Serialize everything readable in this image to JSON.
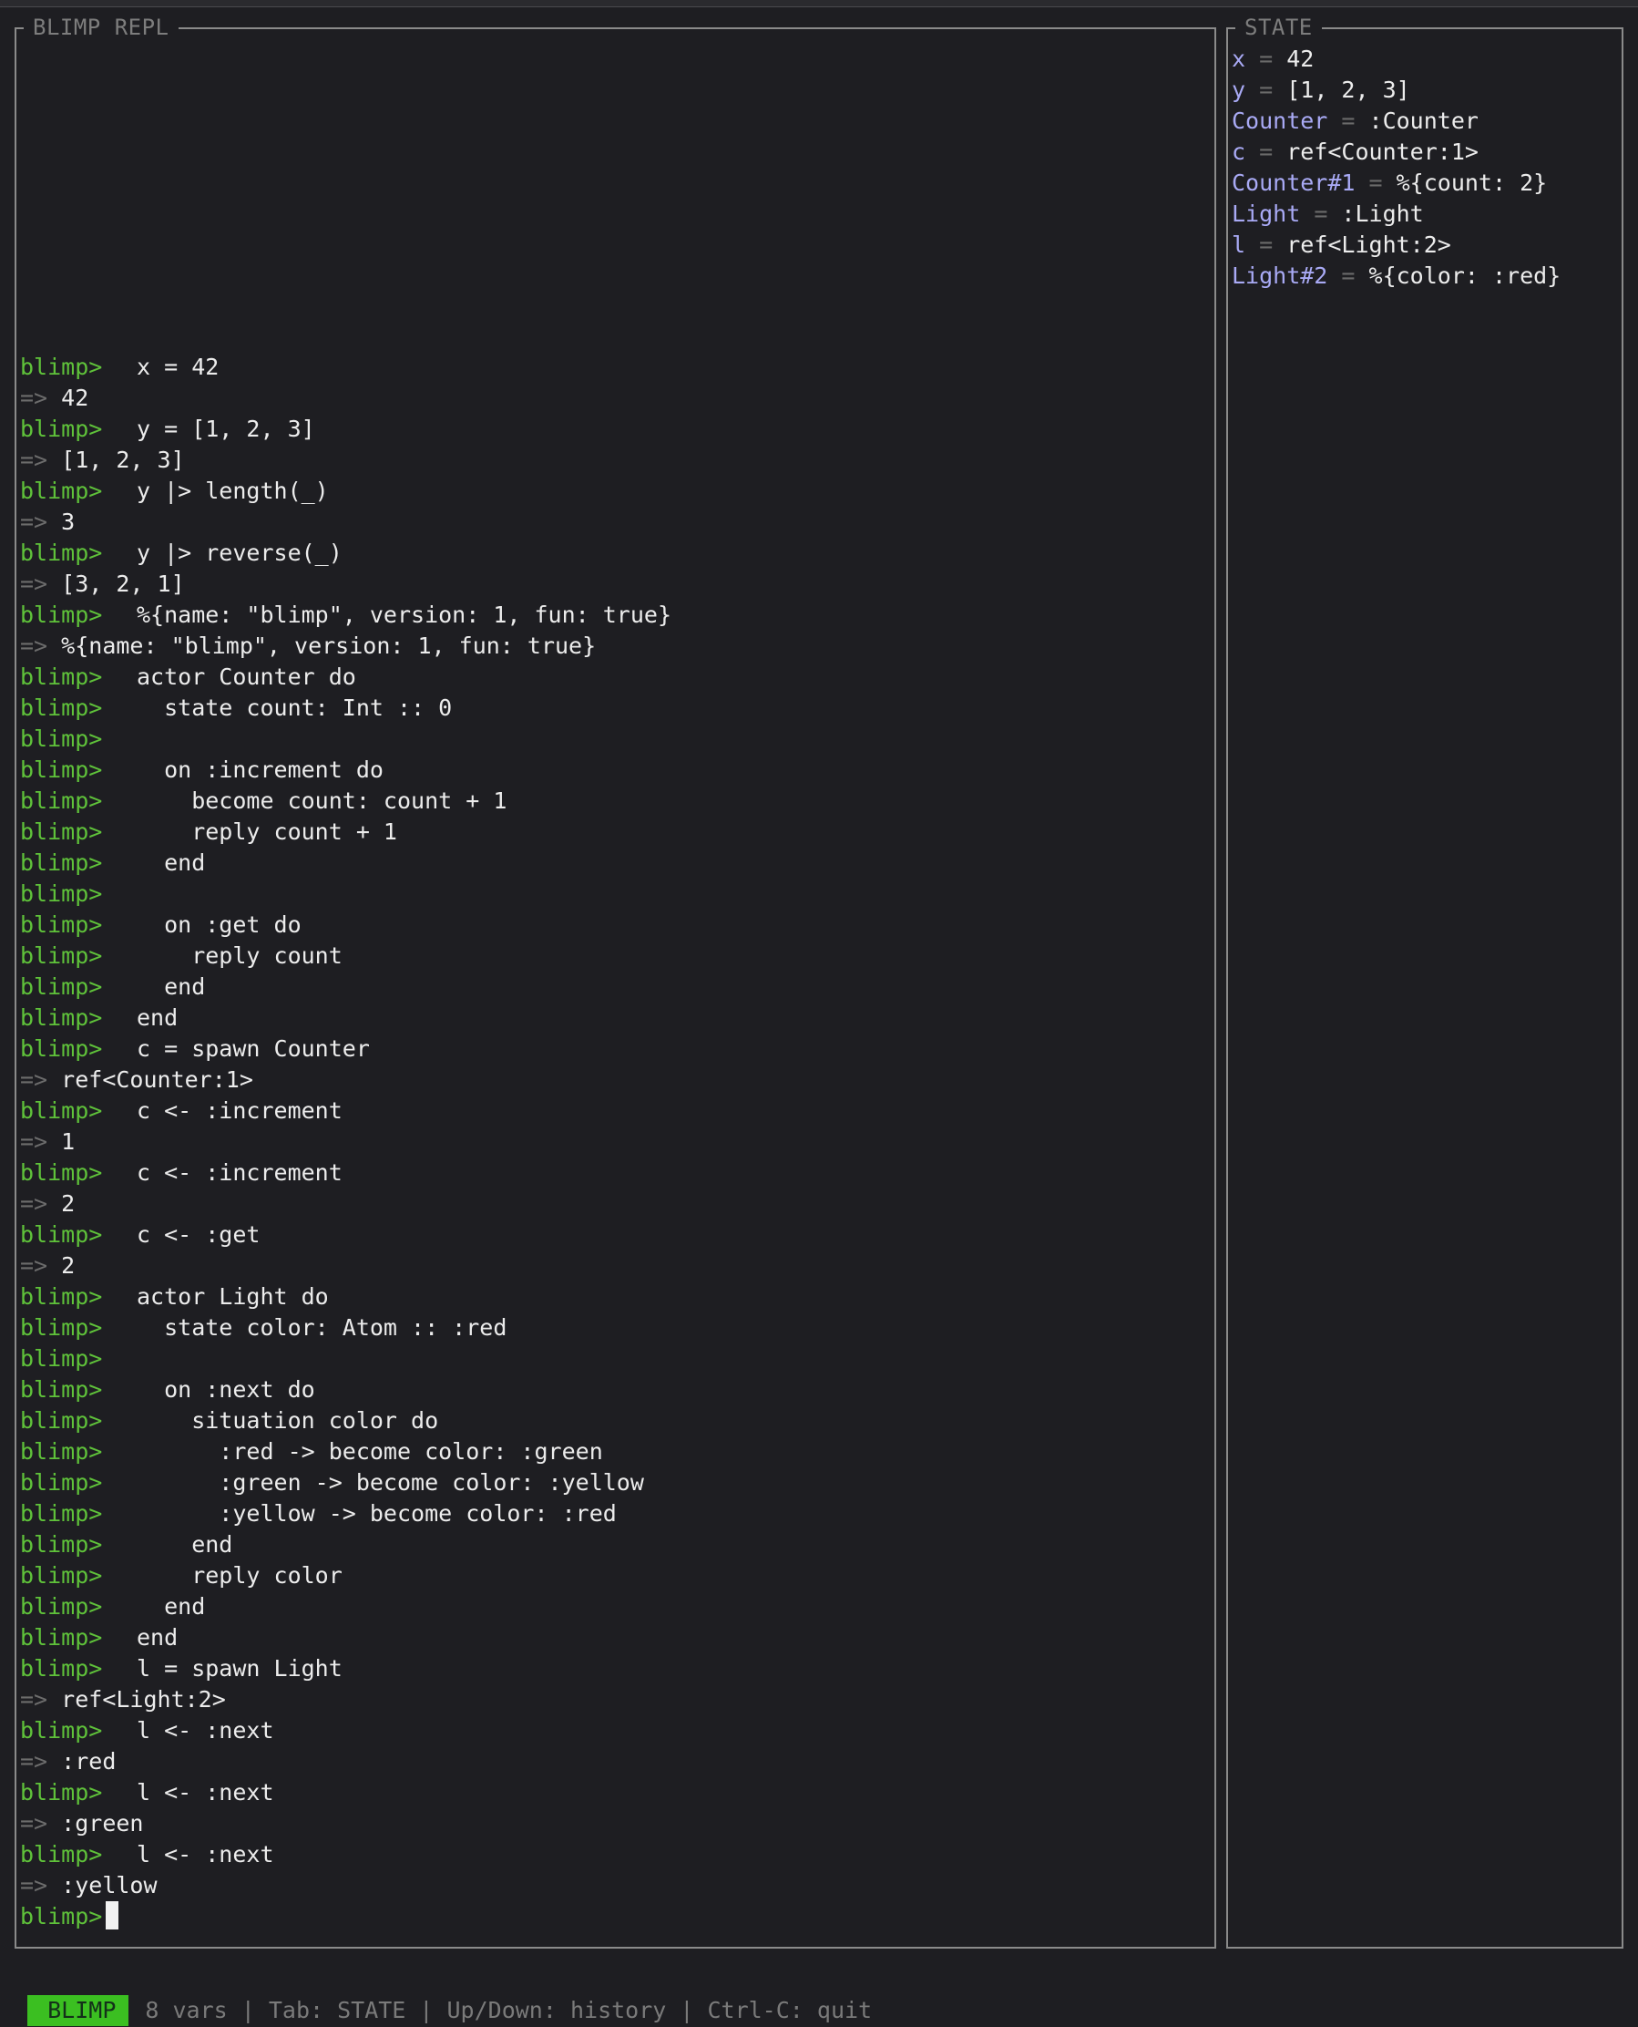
{
  "repl_panel": {
    "title": "BLIMP REPL",
    "prompt": "blimp>",
    "result_marker": "=>",
    "lines": [
      {
        "kind": "in",
        "text": "x = 42"
      },
      {
        "kind": "out",
        "text": "42"
      },
      {
        "kind": "in",
        "text": "y = [1, 2, 3]"
      },
      {
        "kind": "out",
        "text": "[1, 2, 3]"
      },
      {
        "kind": "in",
        "text": "y |> length(_)"
      },
      {
        "kind": "out",
        "text": "3"
      },
      {
        "kind": "in",
        "text": "y |> reverse(_)"
      },
      {
        "kind": "out",
        "text": "[3, 2, 1]"
      },
      {
        "kind": "in",
        "text": "%{name: \"blimp\", version: 1, fun: true}"
      },
      {
        "kind": "out",
        "text": "%{name: \"blimp\", version: 1, fun: true}"
      },
      {
        "kind": "in",
        "text": "actor Counter do"
      },
      {
        "kind": "in",
        "text": "  state count: Int :: 0"
      },
      {
        "kind": "in",
        "text": ""
      },
      {
        "kind": "in",
        "text": "  on :increment do"
      },
      {
        "kind": "in",
        "text": "    become count: count + 1"
      },
      {
        "kind": "in",
        "text": "    reply count + 1"
      },
      {
        "kind": "in",
        "text": "  end"
      },
      {
        "kind": "in",
        "text": ""
      },
      {
        "kind": "in",
        "text": "  on :get do"
      },
      {
        "kind": "in",
        "text": "    reply count"
      },
      {
        "kind": "in",
        "text": "  end"
      },
      {
        "kind": "in",
        "text": "end"
      },
      {
        "kind": "in",
        "text": "c = spawn Counter"
      },
      {
        "kind": "out",
        "text": "ref<Counter:1>"
      },
      {
        "kind": "in",
        "text": "c <- :increment"
      },
      {
        "kind": "out",
        "text": "1"
      },
      {
        "kind": "in",
        "text": "c <- :increment"
      },
      {
        "kind": "out",
        "text": "2"
      },
      {
        "kind": "in",
        "text": "c <- :get"
      },
      {
        "kind": "out",
        "text": "2"
      },
      {
        "kind": "in",
        "text": "actor Light do"
      },
      {
        "kind": "in",
        "text": "  state color: Atom :: :red"
      },
      {
        "kind": "in",
        "text": ""
      },
      {
        "kind": "in",
        "text": "  on :next do"
      },
      {
        "kind": "in",
        "text": "    situation color do"
      },
      {
        "kind": "in",
        "text": "      :red -> become color: :green"
      },
      {
        "kind": "in",
        "text": "      :green -> become color: :yellow"
      },
      {
        "kind": "in",
        "text": "      :yellow -> become color: :red"
      },
      {
        "kind": "in",
        "text": "    end"
      },
      {
        "kind": "in",
        "text": "    reply color"
      },
      {
        "kind": "in",
        "text": "  end"
      },
      {
        "kind": "in",
        "text": "end"
      },
      {
        "kind": "in",
        "text": "l = spawn Light"
      },
      {
        "kind": "out",
        "text": "ref<Light:2>"
      },
      {
        "kind": "in",
        "text": "l <- :next"
      },
      {
        "kind": "out",
        "text": ":red"
      },
      {
        "kind": "in",
        "text": "l <- :next"
      },
      {
        "kind": "out",
        "text": ":green"
      },
      {
        "kind": "in",
        "text": "l <- :next"
      },
      {
        "kind": "out",
        "text": ":yellow"
      },
      {
        "kind": "input",
        "text": ""
      }
    ]
  },
  "state_panel": {
    "title": "STATE",
    "equals": "=",
    "vars": [
      {
        "name": "x",
        "value": "42"
      },
      {
        "name": "y",
        "value": "[1, 2, 3]"
      },
      {
        "name": "Counter",
        "value": ":Counter"
      },
      {
        "name": "c",
        "value": "ref<Counter:1>"
      },
      {
        "name": "Counter#1",
        "value": "%{count: 2}"
      },
      {
        "name": "Light",
        "value": ":Light"
      },
      {
        "name": "l",
        "value": "ref<Light:2>"
      },
      {
        "name": "Light#2",
        "value": "%{color: :red}"
      }
    ]
  },
  "status_bar": {
    "mode": "BLIMP",
    "text": "8 vars | Tab: STATE | Up/Down: history | Ctrl-C: quit"
  },
  "colors": {
    "prompt": "#5fc23a",
    "var_name": "#a9aaf5",
    "badge_bg": "#3bbf21",
    "background": "#1e1e22",
    "border": "#8a8a8a"
  }
}
